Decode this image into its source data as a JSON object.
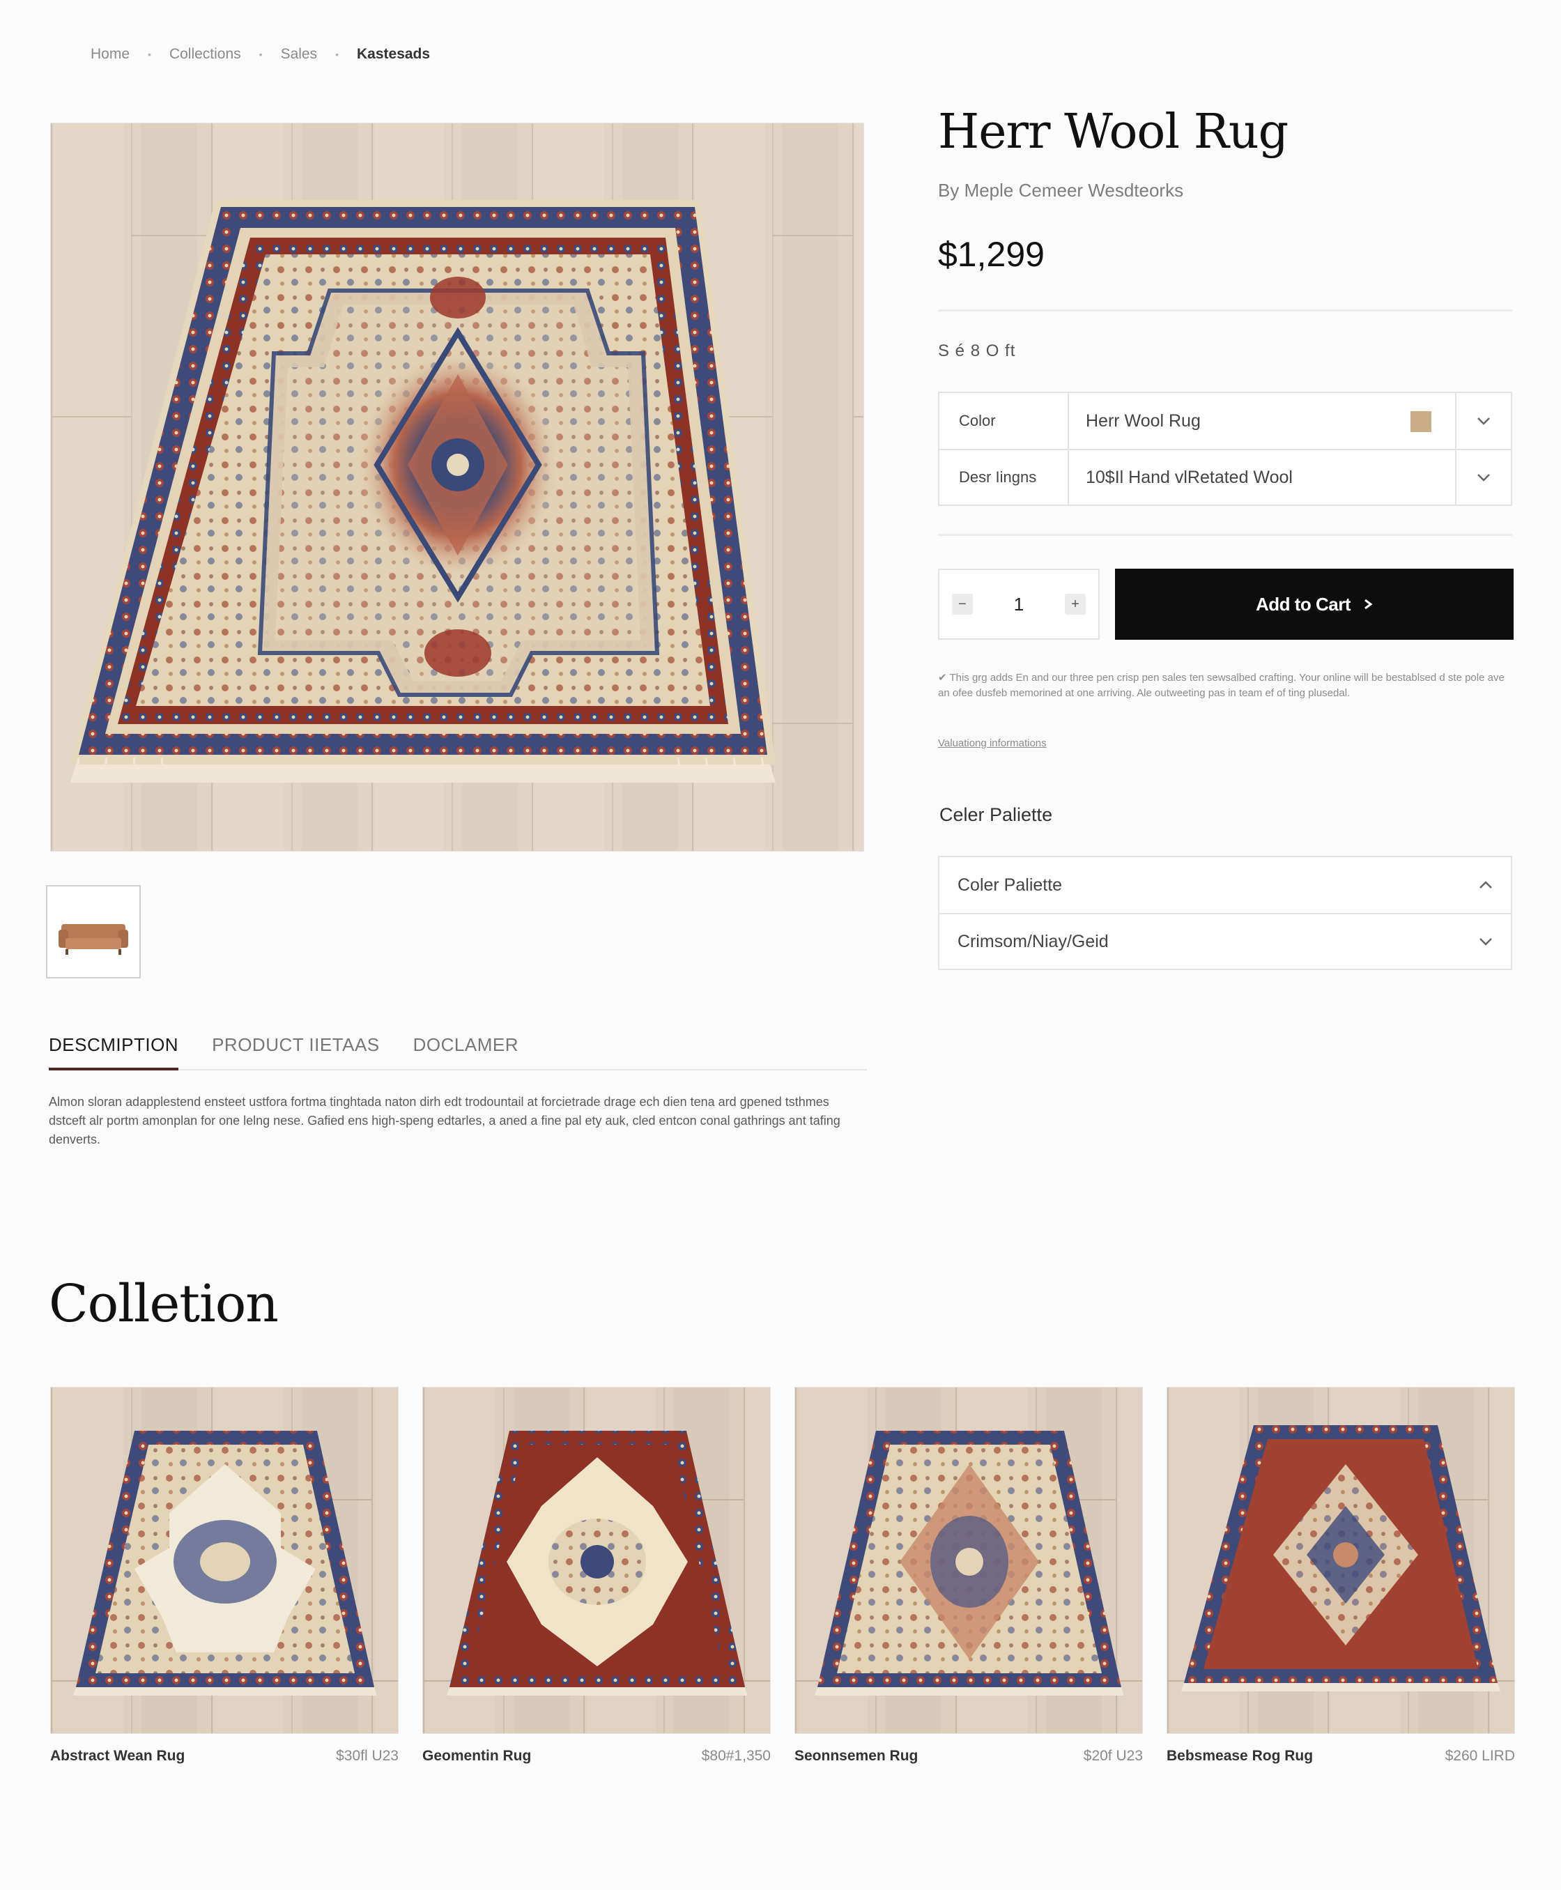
{
  "breadcrumb": {
    "items": [
      "Home",
      "Collections",
      "Sales",
      "Kastesads"
    ]
  },
  "product": {
    "title": "Herr Wool Rug",
    "byline": "By Meple Cemeer Wesdteorks",
    "price": "$1,299",
    "size_label": "S é 8 O ft",
    "options": [
      {
        "label": "Color",
        "value": "Herr Wool Rug",
        "swatch_color": "#c9ad84"
      },
      {
        "label": "Desr Iingns",
        "value": "10$Il Hand vlRetated Wool"
      }
    ],
    "quantity": "1",
    "add_to_cart_label": "Add to Cart",
    "fine_print": "✔ This grg adds En and our three pen crisp pen sales ten sewsalbed crafting. Your online will be bestablsed d ste pole ave an ofee dusfeb memorined at one arriving. Ale outweeting pas in team ef of ting plusedal.",
    "fine_link": "Valuationg informations",
    "palette_heading": "Celer Paliette",
    "palette_accordion": {
      "header": "Coler Paliette",
      "value": "Crimsom/Niay/Geid"
    }
  },
  "tabs": {
    "items": [
      "DESCMIPTION",
      "PRODUCT IIETAAS",
      "DOCLAMER"
    ],
    "active_index": 0,
    "description": "Almon sloran adapplestend ensteet ustfora fortma tinghtada naton dirh edt trodountail at forcietrade drage ech dien tena ard gpened tsthmes dstceft alr portm amonplan for one lelng nese. Gafied ens high-speng edtarles, a aned a fine pal ety auk, cled entcon conal gathrings ant tafing denverts."
  },
  "collection": {
    "title": "Colletion",
    "items": [
      {
        "name": "Abstract Wean Rug",
        "price": "$30fl U23"
      },
      {
        "name": "Geomentin Rug",
        "price": "$80#1,350"
      },
      {
        "name": "Seonnsemen Rug",
        "price": "$20f U23"
      },
      {
        "name": "Bebsmease Rog Rug",
        "price": "$260 LIRD"
      }
    ]
  },
  "colors": {
    "accent": "#0d0d0d",
    "tab_underline": "#4a2a24",
    "rug_red": "#9c3a2c",
    "rug_navy": "#3a4a78",
    "rug_cream": "#e6d8bc"
  }
}
